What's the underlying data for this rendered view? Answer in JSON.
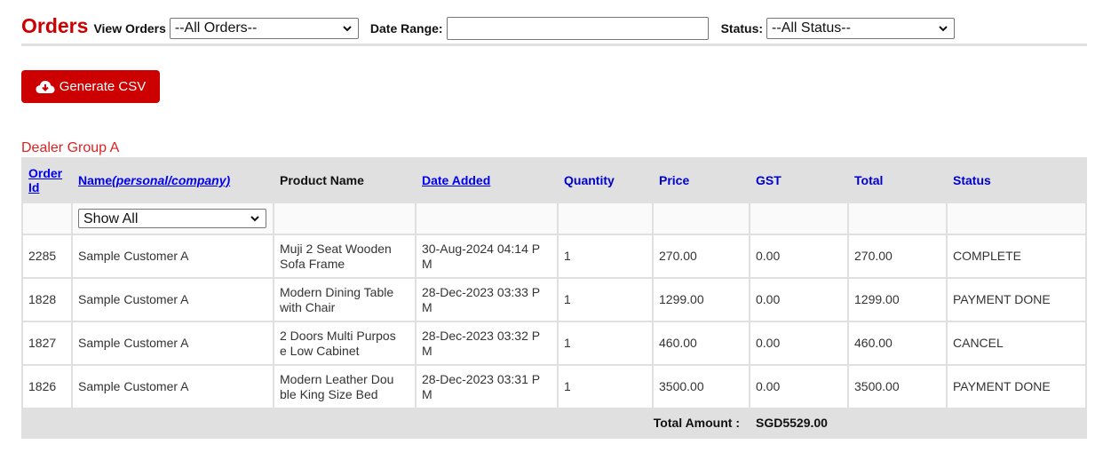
{
  "header": {
    "title": "Orders",
    "view_orders_label": "View Orders",
    "view_orders_value": "--All Orders--",
    "date_range_label": "Date Range:",
    "date_range_value": "",
    "status_label": "Status:",
    "status_value": "--All Status--"
  },
  "toolbar": {
    "generate_csv_label": "Generate CSV",
    "generate_csv_icon": "cloud-download-icon"
  },
  "colors": {
    "brand_red": "#cc0000",
    "link_blue": "#0000ee",
    "table_bg": "#e0e0e0"
  },
  "group": {
    "title": "Dealer Group A",
    "columns": [
      {
        "label": "Order Id",
        "line1": "Order",
        "line2": "Id",
        "sortable": true
      },
      {
        "label": "Name",
        "suffix": "(personal/company)",
        "sortable": true
      },
      {
        "label": "Product Name",
        "sortable": false
      },
      {
        "label": "Date Added",
        "sortable": true
      },
      {
        "label": "Quantity",
        "sortable": false
      },
      {
        "label": "Price",
        "sortable": false
      },
      {
        "label": "GST",
        "sortable": false
      },
      {
        "label": "Total",
        "sortable": false
      },
      {
        "label": "Status",
        "sortable": false
      }
    ],
    "name_filter_value": "Show All",
    "rows": [
      {
        "order_id": "2285",
        "name": "Sample Customer A",
        "product_l1": "Muji 2 Seat Wooden",
        "product_l2": "Sofa Frame",
        "date_l1": "30-Aug-2024 04:14 P",
        "date_l2": "M",
        "quantity": "1",
        "price": "270.00",
        "gst": "0.00",
        "total": "270.00",
        "status": "COMPLETE"
      },
      {
        "order_id": "1828",
        "name": "Sample Customer A",
        "product_l1": "Modern Dining Table",
        "product_l2": "with Chair",
        "date_l1": "28-Dec-2023 03:33 P",
        "date_l2": "M",
        "quantity": "1",
        "price": "1299.00",
        "gst": "0.00",
        "total": "1299.00",
        "status": "PAYMENT DONE"
      },
      {
        "order_id": "1827",
        "name": "Sample Customer A",
        "product_l1": "2 Doors Multi Purpos",
        "product_l2": "e Low Cabinet",
        "date_l1": "28-Dec-2023 03:32 P",
        "date_l2": "M",
        "quantity": "1",
        "price": "460.00",
        "gst": "0.00",
        "total": "460.00",
        "status": "CANCEL"
      },
      {
        "order_id": "1826",
        "name": "Sample Customer A",
        "product_l1": "Modern Leather Dou",
        "product_l2": "ble King Size Bed",
        "date_l1": "28-Dec-2023 03:31 P",
        "date_l2": "M",
        "quantity": "1",
        "price": "3500.00",
        "gst": "0.00",
        "total": "3500.00",
        "status": "PAYMENT DONE"
      }
    ],
    "total_label": "Total Amount :",
    "total_value": "SGD5529.00"
  }
}
